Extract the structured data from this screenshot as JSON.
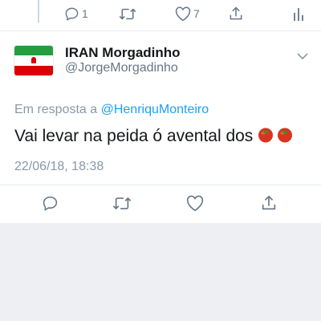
{
  "top_actions": {
    "reply_count": "1",
    "retweet_count": "",
    "like_count": "7"
  },
  "tweet": {
    "display_name": "IRAN Morgadinho",
    "handle": "@JorgeMorgadinho",
    "reply_prefix": "Em resposta a ",
    "reply_mention": "@HenriquMonteiro",
    "text": "Vai levar na peida ó avental dos",
    "timestamp": "22/06/18, 18:38"
  },
  "icons": {
    "reply": "reply-icon",
    "retweet": "retweet-icon",
    "like": "heart-icon",
    "share": "share-icon",
    "analytics": "analytics-icon",
    "menu": "chevron-down-icon",
    "avatar": "iran-flag-avatar",
    "emoji": "tomato-emoji"
  },
  "colors": {
    "link": "#1da1f2",
    "muted": "#657786",
    "flag_green": "#239f40",
    "flag_red": "#da0000"
  }
}
